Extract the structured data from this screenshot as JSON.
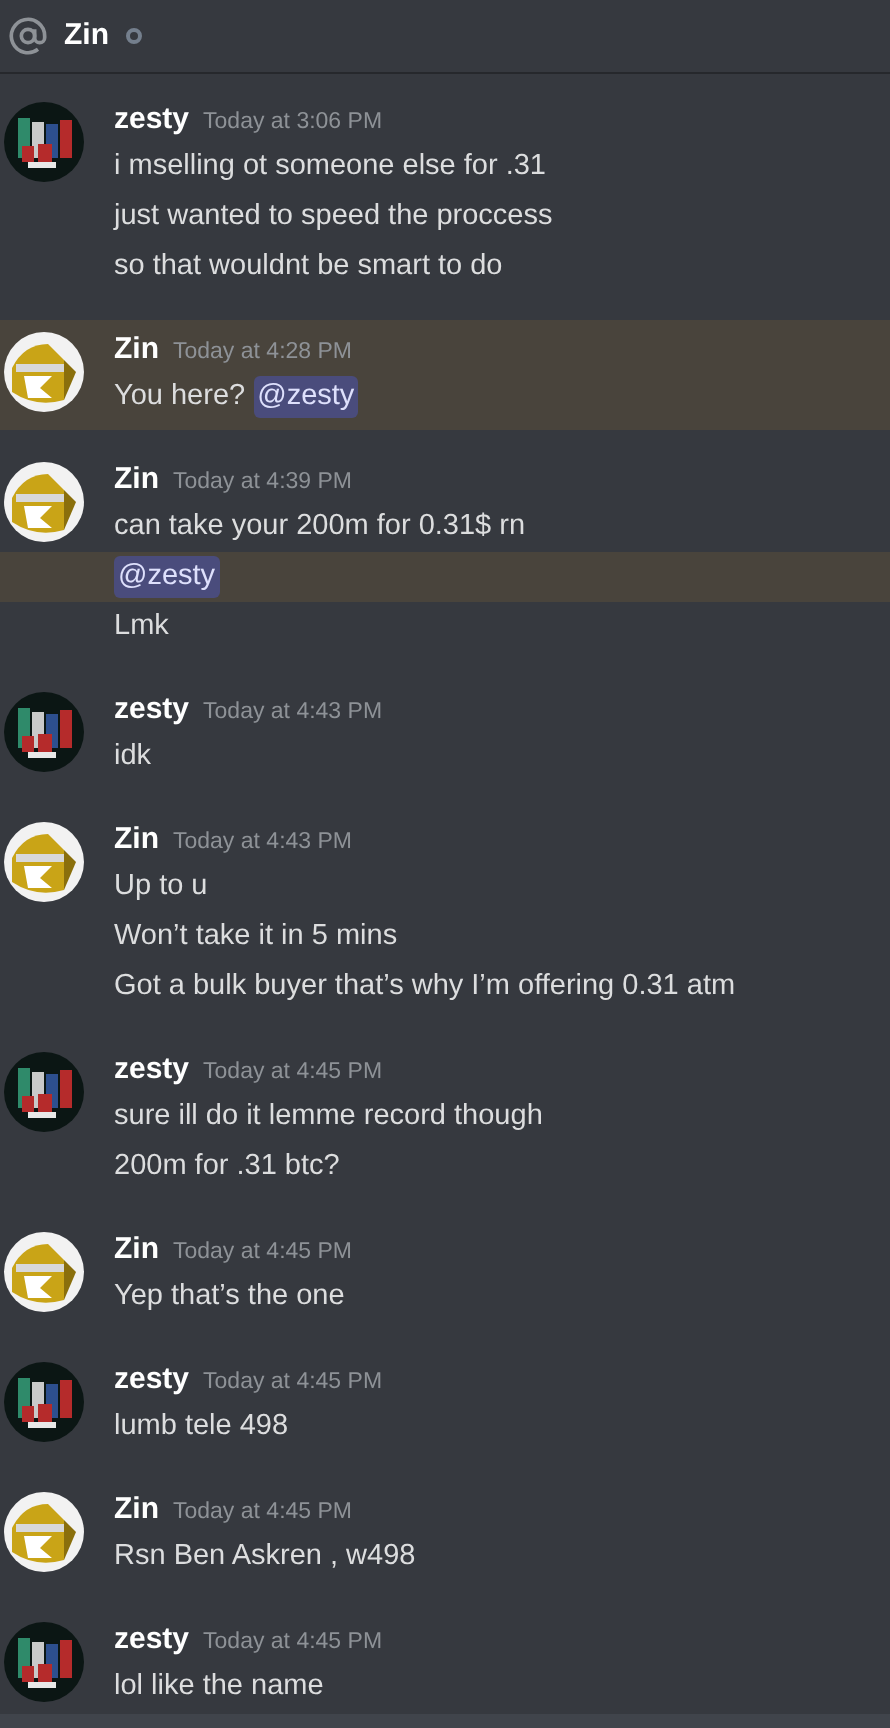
{
  "header": {
    "title": "Zin"
  },
  "messages": [
    {
      "author": "zesty",
      "avatar": {
        "kind": "chips"
      },
      "time": "Today at 3:06 PM",
      "highlighted": false,
      "lines": [
        {
          "text": "i mselling ot someone else for .31",
          "highlighted": false
        },
        {
          "text": "just wanted to speed the proccess",
          "highlighted": false
        },
        {
          "text": "so that wouldnt be smart to do",
          "highlighted": false
        }
      ]
    },
    {
      "author": "Zin",
      "avatar": {
        "kind": "helmet"
      },
      "time": "Today at 4:28 PM",
      "highlighted": true,
      "lines": [
        {
          "text": "You here?",
          "mention": "@zesty",
          "highlighted": false
        }
      ]
    },
    {
      "author": "Zin",
      "avatar": {
        "kind": "helmet"
      },
      "time": "Today at 4:39 PM",
      "highlighted": false,
      "lines": [
        {
          "text": "can take your 200m for 0.31$ rn",
          "highlighted": false
        },
        {
          "mention": "@zesty",
          "highlighted": true
        },
        {
          "text": "Lmk",
          "highlighted": false
        }
      ]
    },
    {
      "author": "zesty",
      "avatar": {
        "kind": "chips"
      },
      "time": "Today at 4:43 PM",
      "highlighted": false,
      "lines": [
        {
          "text": "idk",
          "highlighted": false
        }
      ]
    },
    {
      "author": "Zin",
      "avatar": {
        "kind": "helmet"
      },
      "time": "Today at 4:43 PM",
      "highlighted": false,
      "lines": [
        {
          "text": "Up to u",
          "highlighted": false
        },
        {
          "text": "Won’t take it in 5 mins",
          "highlighted": false
        },
        {
          "text": "Got a bulk buyer that’s why I’m offering 0.31 atm",
          "highlighted": false
        }
      ]
    },
    {
      "author": "zesty",
      "avatar": {
        "kind": "chips"
      },
      "time": "Today at 4:45 PM",
      "highlighted": false,
      "lines": [
        {
          "text": "sure ill do it lemme record though",
          "highlighted": false
        },
        {
          "text": "200m for .31 btc?",
          "highlighted": false
        }
      ]
    },
    {
      "author": "Zin",
      "avatar": {
        "kind": "helmet"
      },
      "time": "Today at 4:45 PM",
      "highlighted": false,
      "lines": [
        {
          "text": "Yep that’s the one",
          "highlighted": false
        }
      ]
    },
    {
      "author": "zesty",
      "avatar": {
        "kind": "chips"
      },
      "time": "Today at 4:45 PM",
      "highlighted": false,
      "lines": [
        {
          "text": "lumb tele 498",
          "highlighted": false
        }
      ]
    },
    {
      "author": "Zin",
      "avatar": {
        "kind": "helmet"
      },
      "time": "Today at 4:45 PM",
      "highlighted": false,
      "lines": [
        {
          "text": "Rsn Ben Askren , w498",
          "highlighted": false
        }
      ]
    },
    {
      "author": "zesty",
      "avatar": {
        "kind": "chips"
      },
      "time": "Today at 4:45 PM",
      "highlighted": false,
      "lines": [
        {
          "text": "lol like the name",
          "highlighted": false
        }
      ]
    }
  ]
}
